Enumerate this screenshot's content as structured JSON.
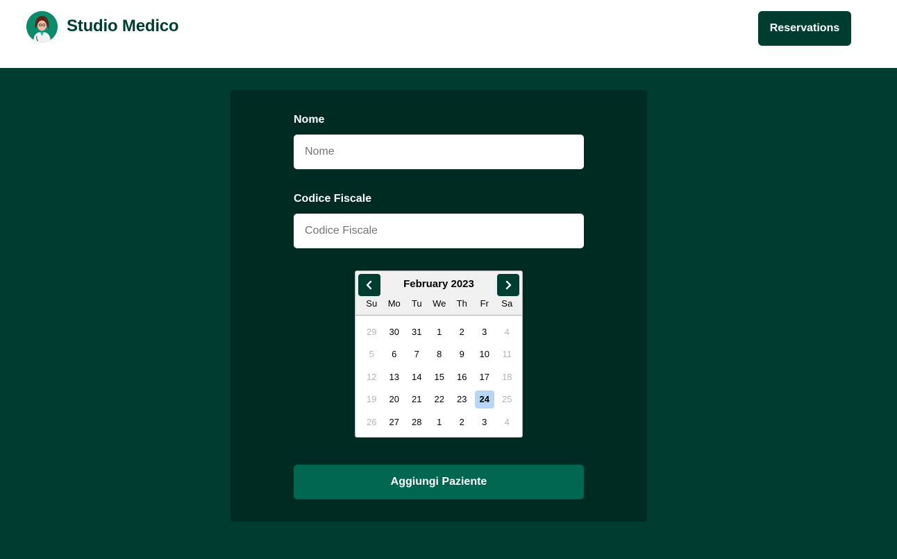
{
  "header": {
    "brand": "Studio Medico",
    "reservations_label": "Reservations"
  },
  "form": {
    "nome_label": "Nome",
    "nome_placeholder": "Nome",
    "cf_label": "Codice Fiscale",
    "cf_placeholder": "Codice Fiscale",
    "submit_label": "Aggiungi Paziente"
  },
  "calendar": {
    "month": "February 2023",
    "days_of_week": [
      "Su",
      "Mo",
      "Tu",
      "We",
      "Th",
      "Fr",
      "Sa"
    ],
    "weeks": [
      [
        {
          "d": "29",
          "m": true
        },
        {
          "d": "30"
        },
        {
          "d": "31"
        },
        {
          "d": "1"
        },
        {
          "d": "2"
        },
        {
          "d": "3"
        },
        {
          "d": "4",
          "m": true
        }
      ],
      [
        {
          "d": "5",
          "m": true
        },
        {
          "d": "6"
        },
        {
          "d": "7"
        },
        {
          "d": "8"
        },
        {
          "d": "9"
        },
        {
          "d": "10"
        },
        {
          "d": "11",
          "m": true
        }
      ],
      [
        {
          "d": "12",
          "m": true
        },
        {
          "d": "13"
        },
        {
          "d": "14"
        },
        {
          "d": "15"
        },
        {
          "d": "16"
        },
        {
          "d": "17"
        },
        {
          "d": "18",
          "m": true
        }
      ],
      [
        {
          "d": "19",
          "m": true
        },
        {
          "d": "20"
        },
        {
          "d": "21"
        },
        {
          "d": "22"
        },
        {
          "d": "23"
        },
        {
          "d": "24",
          "selected": true
        },
        {
          "d": "25",
          "m": true
        }
      ],
      [
        {
          "d": "26",
          "m": true
        },
        {
          "d": "27"
        },
        {
          "d": "28"
        },
        {
          "d": "1"
        },
        {
          "d": "2"
        },
        {
          "d": "3"
        },
        {
          "d": "4",
          "m": true
        }
      ]
    ]
  },
  "colors": {
    "primary": "#003d31",
    "card": "#002b22",
    "button": "#006650",
    "selected_day": "#b8d6f2"
  },
  "icons": {
    "logo": "doctor-avatar-icon",
    "prev": "chevron-left-icon",
    "next": "chevron-right-icon"
  }
}
